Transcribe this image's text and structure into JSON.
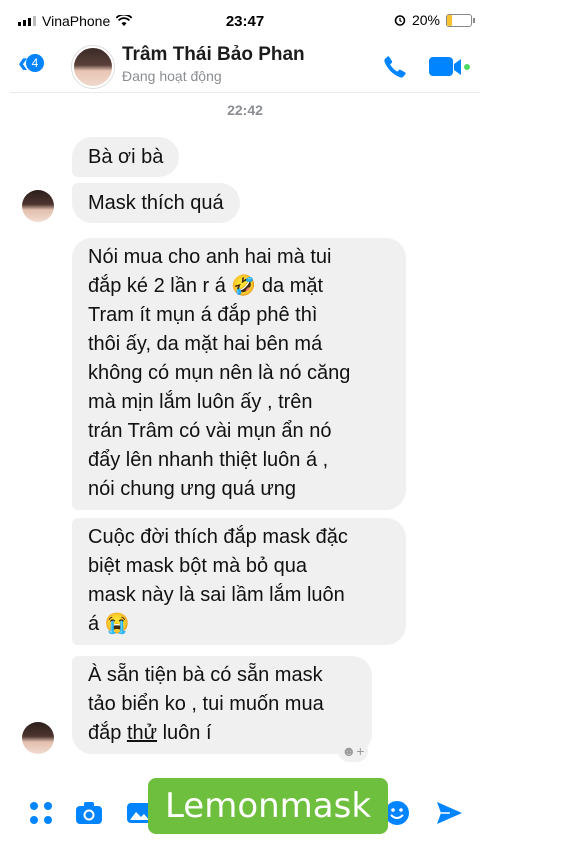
{
  "status_bar": {
    "carrier": "VinaPhone",
    "time": "23:47",
    "battery_percent": "20%",
    "battery_level": 0.2
  },
  "header": {
    "back_count": "4",
    "contact_name": "Trâm Thái Bảo Phan",
    "contact_status": "Đang hoạt động",
    "accent_color": "#0084ff"
  },
  "conversation": {
    "timestamp": "22:42",
    "messages": [
      {
        "text": "Bà ơi bà"
      },
      {
        "text": "Mask thích quá"
      },
      {
        "lines": [
          "Nói mua cho anh hai mà tui",
          "đắp ké 2 lần r á 🤣 da mặt",
          "Tram ít mụn á đắp phê thì",
          "thôi ấy, da mặt hai bên má",
          "không có mụn nên là nó căng",
          "mà mịn lắm luôn ấy , trên",
          "trán Trâm có vài mụn ẩn nó",
          "đẩy lên nhanh thiệt luôn á ,",
          "nói chung ưng quá ưng"
        ]
      },
      {
        "lines": [
          "Cuộc đời thích đắp mask đặc",
          "biệt mask bột mà bỏ qua",
          "mask này là sai lầm lắm luôn",
          "á 😭"
        ]
      },
      {
        "line1": "À sẵn tiện bà có sẵn mask",
        "line2": "tảo biển ko , tui muốn mua",
        "line3_a": "đắp ",
        "line3_b": "thử",
        "line3_c": " luôn í"
      }
    ],
    "reaction_placeholder": "☻+"
  },
  "composer": {
    "icons": [
      "grid-icon",
      "camera-icon",
      "photo-icon",
      "emoji-icon",
      "send-icon"
    ]
  },
  "watermark": {
    "text": "Lemonmask",
    "color": "#6fbf3e"
  }
}
